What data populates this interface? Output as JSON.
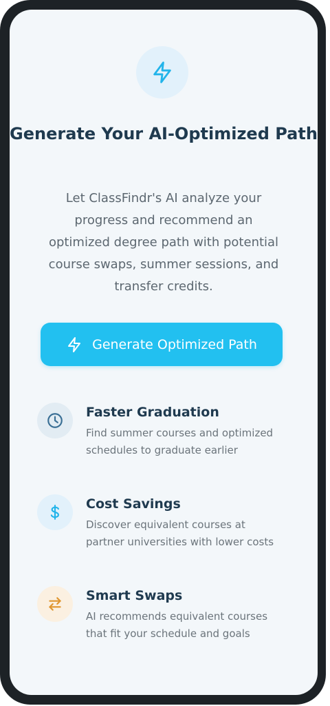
{
  "header": {
    "icon": "lightning-icon",
    "title": "Generate Your AI-Optimized Path",
    "description": "Let ClassFindr's AI analyze your progress and recommend an optimized degree path with potential course swaps, summer sessions, and transfer credits."
  },
  "cta": {
    "icon": "lightning-icon",
    "label": "Generate Optimized Path"
  },
  "features": [
    {
      "icon": "clock-icon",
      "title": "Faster Graduation",
      "description": "Find summer courses and optimized schedules to graduate earlier"
    },
    {
      "icon": "dollar-icon",
      "title": "Cost Savings",
      "description": "Discover equivalent courses at partner universities with lower costs"
    },
    {
      "icon": "swap-arrows-icon",
      "title": "Smart Swaps",
      "description": "AI recommends equivalent courses that fit your schedule and goals"
    }
  ],
  "colors": {
    "accent": "#22c0f0",
    "title": "#1f3a4f",
    "background": "#f3f7fa",
    "frame": "#1d2226",
    "swap_icon": "#e0962f",
    "clock_icon": "#3a6f95"
  }
}
